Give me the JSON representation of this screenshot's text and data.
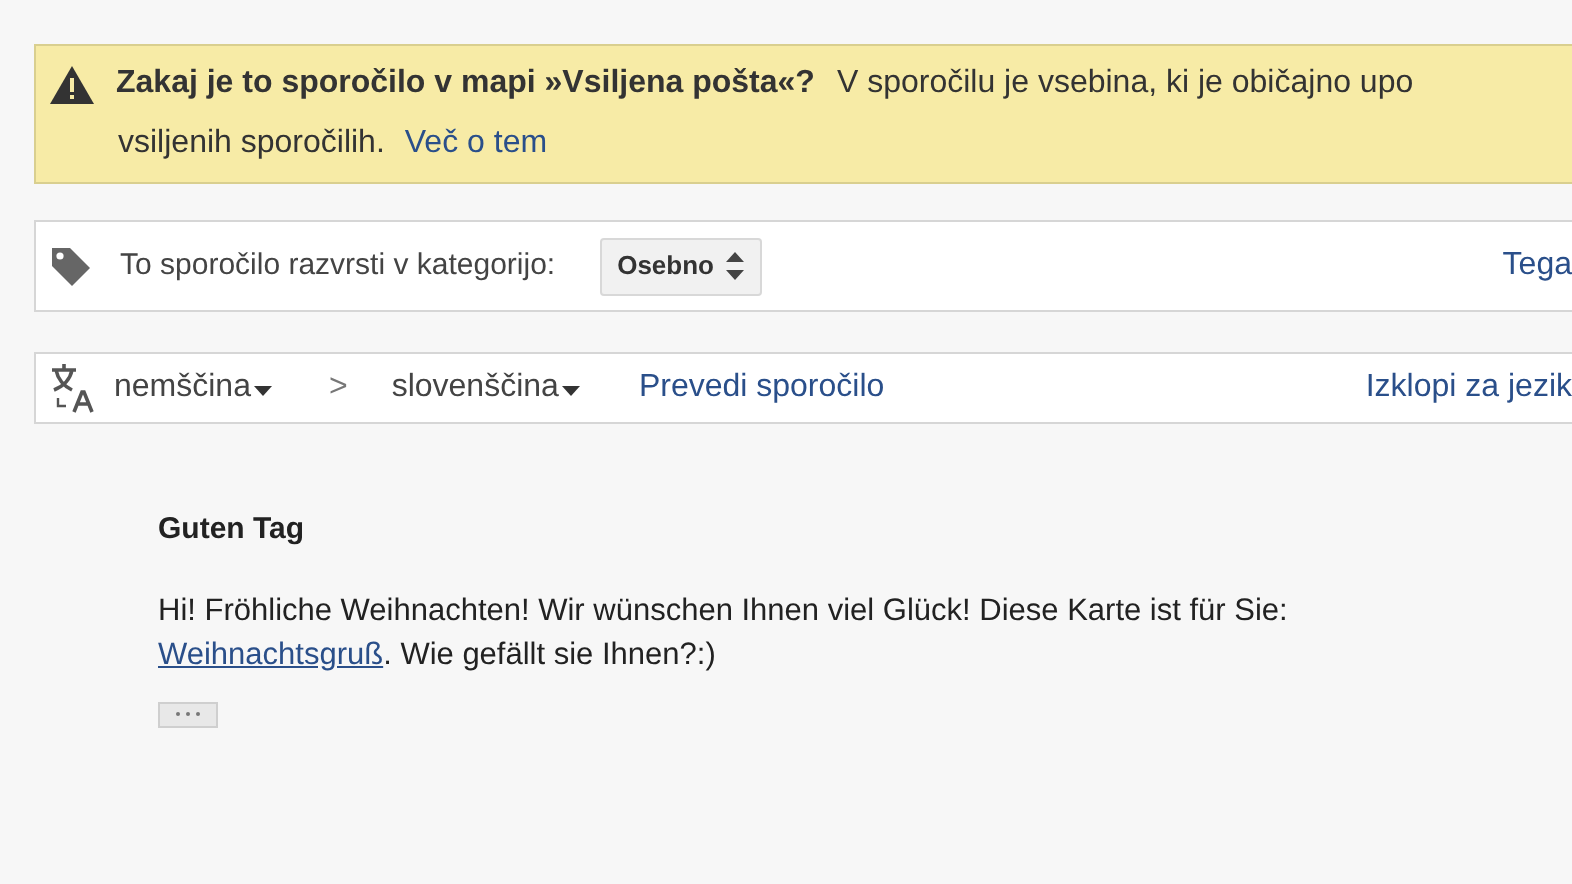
{
  "spam_notice": {
    "title": "Zakaj je to sporočilo v mapi »Vsiljena pošta«?",
    "text_line1": "V sporočilu je vsebina, ki je običajno upo",
    "text_line2": "vsiljenih sporočilih.",
    "link": "Več o tem"
  },
  "category_bar": {
    "label": "To sporočilo razvrsti v kategorijo:",
    "select": {
      "value": "Osebno"
    },
    "right_link": "Tega"
  },
  "translate_bar": {
    "source_language": "nemščina",
    "separator": ">",
    "target_language": "slovenščina",
    "translate_link": "Prevedi sporočilo",
    "right_link": "Izklopi za jezik"
  },
  "message": {
    "greeting": "Guten Tag",
    "body_before": "Hi! Fröhliche Weihnachten! Wir wünschen Ihnen viel Glück! Diese Karte ist für Sie:",
    "link": "Weihnachtsgruß",
    "body_after": ". Wie gefällt sie Ihnen?:)"
  }
}
